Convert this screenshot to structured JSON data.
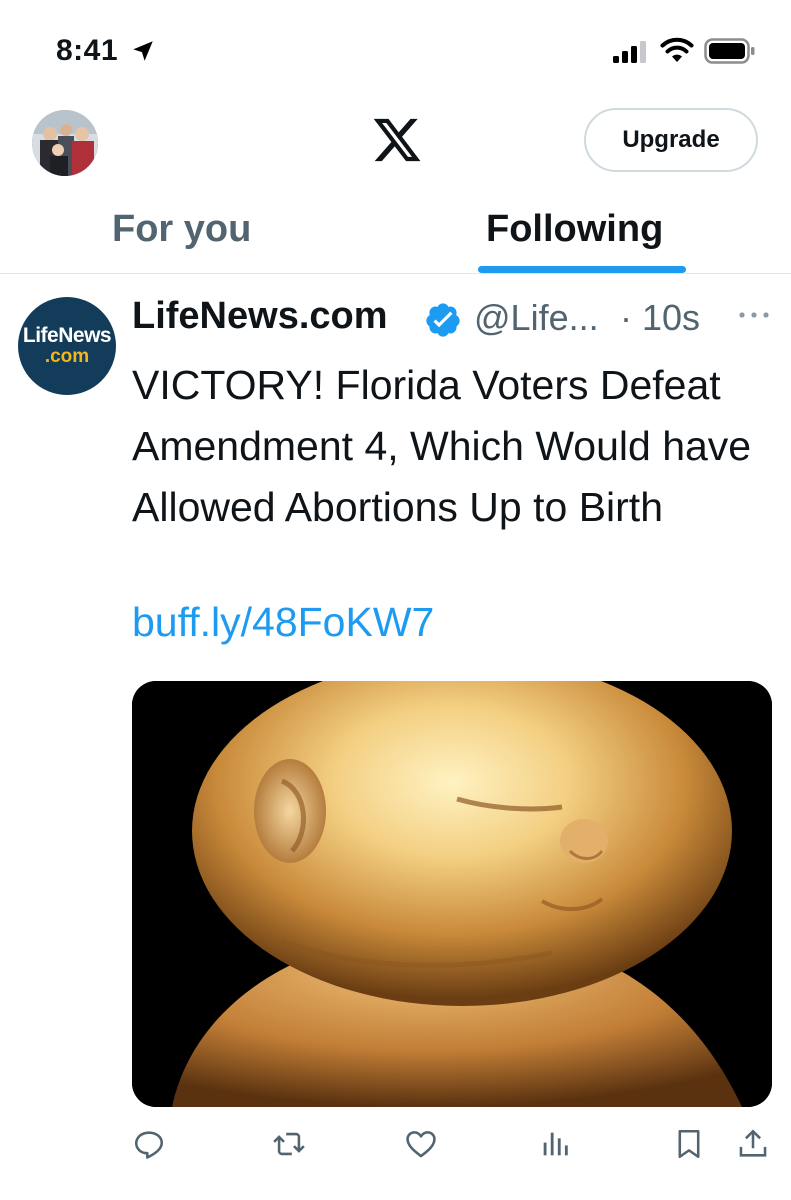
{
  "status_bar": {
    "time": "8:41",
    "icons": [
      "location-arrow-icon",
      "cellular-signal-icon",
      "wifi-icon",
      "battery-icon"
    ]
  },
  "header": {
    "logo": "x-logo",
    "upgrade_label": "Upgrade"
  },
  "tabs": [
    {
      "label": "For you",
      "active": false
    },
    {
      "label": "Following",
      "active": true
    }
  ],
  "tweet": {
    "avatar_text_1": "LifeNews",
    "avatar_text_2": ".com",
    "author_name": "LifeNews.com",
    "verified": true,
    "handle": "@Life...",
    "time": "· 10s",
    "text": "VICTORY! Florida Voters Defeat Amendment 4, Which Would have Allowed Abortions Up to Birth",
    "link": "buff.ly/48FoKW7",
    "media": "fetus-photo",
    "actions": [
      "reply-icon",
      "retweet-icon",
      "like-icon",
      "views-icon",
      "bookmark-icon",
      "share-icon"
    ]
  },
  "colors": {
    "accent": "#1d9bf0",
    "text_primary": "#0f1419",
    "text_secondary": "#536471",
    "divider": "#e1e8ed"
  }
}
